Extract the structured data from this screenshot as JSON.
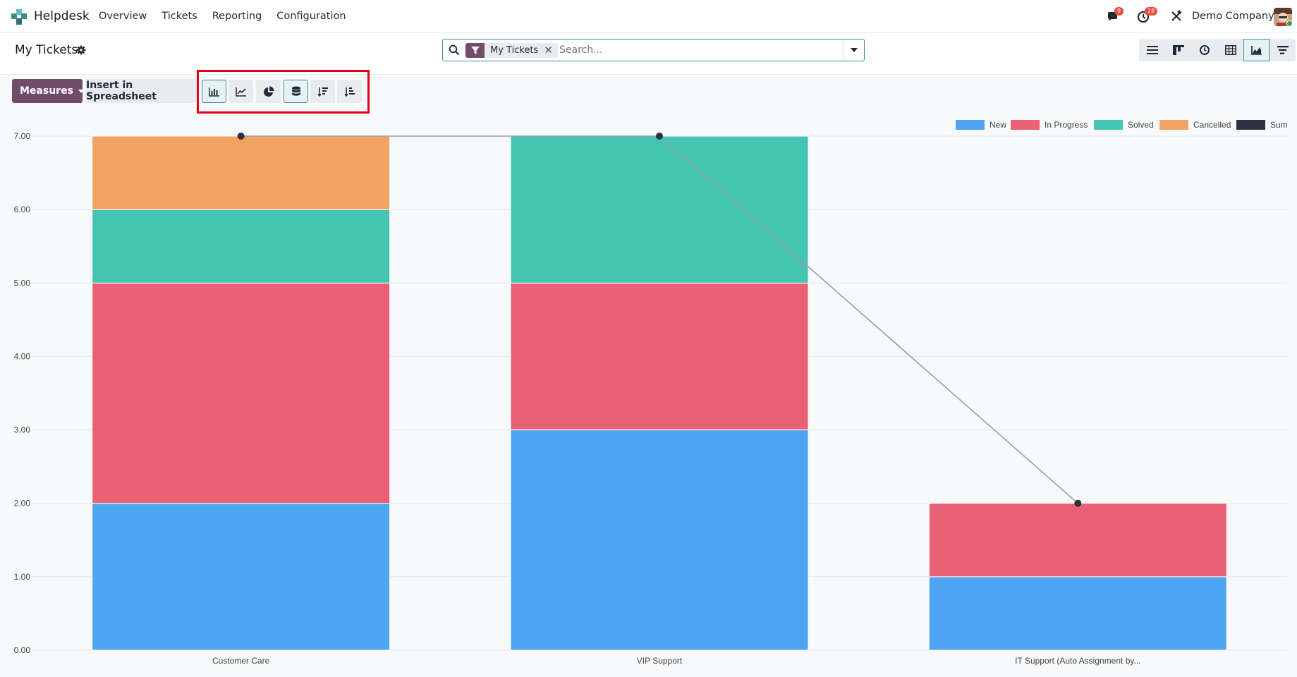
{
  "navbar": {
    "app_name": "Helpdesk",
    "menu": [
      "Overview",
      "Tickets",
      "Reporting",
      "Configuration"
    ],
    "messages_count": "9",
    "activities_count": "28",
    "company": "Demo Company"
  },
  "control": {
    "breadcrumb": "My Tickets",
    "search": {
      "facet_label": "My Tickets",
      "placeholder": "Search..."
    }
  },
  "toolbar": {
    "measures_label": "Measures",
    "insert_label": "Insert in Spreadsheet"
  },
  "colors": {
    "accent": "#714b67",
    "teal": "#3d8c93",
    "new": "#4ea6f2",
    "in_progress": "#ea6074",
    "solved": "#44c5b1",
    "cancelled": "#f2a262",
    "sum": "#2d3142"
  },
  "chart_data": {
    "type": "bar",
    "stacked": true,
    "categories": [
      "Customer Care",
      "VIP Support",
      "IT Support (Auto Assignment by..."
    ],
    "series": [
      {
        "name": "New",
        "values": [
          2,
          3,
          1
        ]
      },
      {
        "name": "In Progress",
        "values": [
          3,
          2,
          1
        ]
      },
      {
        "name": "Solved",
        "values": [
          1,
          2,
          0
        ]
      },
      {
        "name": "Cancelled",
        "values": [
          1,
          0,
          0
        ]
      }
    ],
    "line_series": {
      "name": "Sum",
      "values": [
        7,
        7,
        2
      ]
    },
    "ylim": [
      0,
      7
    ],
    "yticks": [
      "0.00",
      "1.00",
      "2.00",
      "3.00",
      "4.00",
      "5.00",
      "6.00",
      "7.00"
    ],
    "legend_position": "top-right",
    "grid": true
  }
}
